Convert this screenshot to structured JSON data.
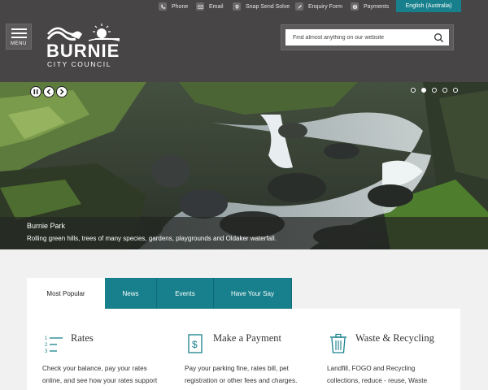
{
  "utility": {
    "phone": "Phone",
    "email": "Email",
    "snap": "Snap Send Solve",
    "enquiry": "Enquiry Form",
    "payments": "Payments",
    "language": "English (Australia)"
  },
  "header": {
    "menu_label": "MENU",
    "logo_title": "BURNIE",
    "logo_subtitle": "CITY COUNCIL",
    "search_placeholder": "Find almost anything on our website"
  },
  "hero": {
    "title": "Burnie Park",
    "description": "Rolling green hills, trees of many species, gardens, playgrounds and Oldaker waterfall.",
    "slide_count": 5,
    "active_slide": 2
  },
  "tabs": [
    {
      "label": "Most Popular",
      "active": true
    },
    {
      "label": "News",
      "active": false
    },
    {
      "label": "Events",
      "active": false
    },
    {
      "label": "Have Your Say",
      "active": false
    }
  ],
  "cards": [
    {
      "icon": "list-icon",
      "title": "Rates",
      "text": "Check your balance, pay your rates online, and see how your rates support local services."
    },
    {
      "icon": "dollar-document-icon",
      "title": "Make a Payment",
      "text": "Pay your parking fine, rates bill, pet registration or other fees and charges."
    },
    {
      "icon": "bin-icon",
      "title": "Waste & Recycling",
      "text": "Landfill, FOGO and Recycling collections, reduce - reuse, Waste Management Centre and Find"
    }
  ],
  "colors": {
    "header_bg": "#474546",
    "accent": "#17808c",
    "page_bg": "#f1f1f1"
  }
}
